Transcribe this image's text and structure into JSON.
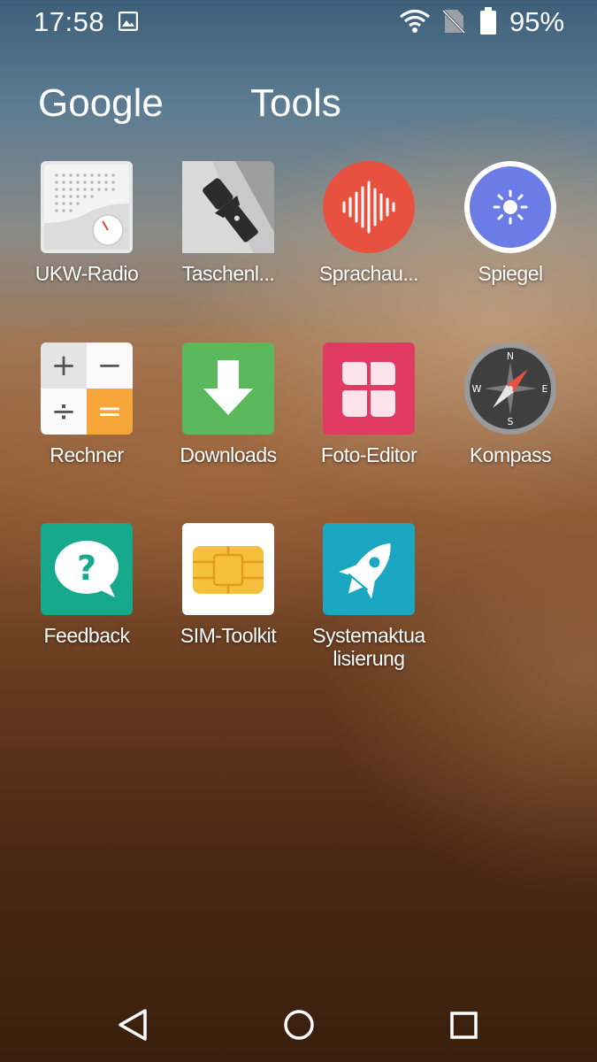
{
  "status_bar": {
    "time": "17:58",
    "battery_percent": "95%",
    "icons": [
      "image-notification-icon",
      "wifi-icon",
      "no-sim-icon",
      "battery-icon"
    ]
  },
  "folder_tabs": [
    {
      "label": "Google"
    },
    {
      "label": "Tools"
    }
  ],
  "apps": [
    {
      "label": "UKW-Radio",
      "icon": "radio-icon"
    },
    {
      "label": "Taschenl...",
      "icon": "flashlight-icon"
    },
    {
      "label": "Sprachau...",
      "icon": "voice-recorder-icon"
    },
    {
      "label": "Spiegel",
      "icon": "mirror-icon"
    },
    {
      "label": "Rechner",
      "icon": "calculator-icon"
    },
    {
      "label": "Downloads",
      "icon": "download-icon"
    },
    {
      "label": "Foto-Editor",
      "icon": "photo-editor-icon"
    },
    {
      "label": "Kompass",
      "icon": "compass-icon"
    },
    {
      "label": "Feedback",
      "icon": "feedback-icon"
    },
    {
      "label": "SIM-Toolkit",
      "icon": "sim-card-icon"
    },
    {
      "label": "Systemaktua lisierung",
      "icon": "rocket-icon"
    }
  ],
  "calculator_keys": [
    "+",
    "−",
    "÷",
    "="
  ],
  "compass_points": [
    "N",
    "E",
    "S",
    "W"
  ],
  "feedback_glyph": "?",
  "nav_bar": [
    "back-icon",
    "home-icon",
    "recents-icon"
  ],
  "colors": {
    "voice_recorder": "#e8503f",
    "mirror": "#6b7ce6",
    "downloads": "#5cb85c",
    "photo_editor": "#e13b64",
    "feedback": "#17a98c",
    "system_update": "#1ba7c2",
    "calculator_accent": "#f6a53a"
  }
}
